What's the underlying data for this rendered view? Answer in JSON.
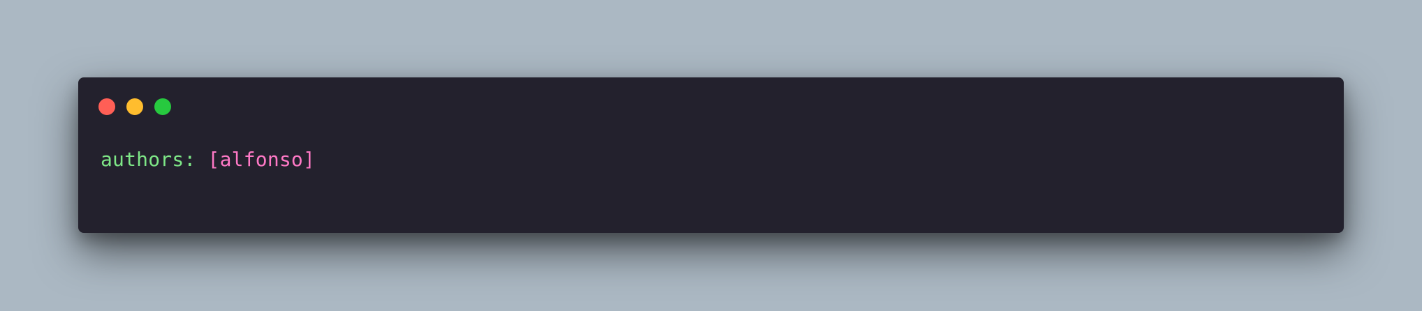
{
  "window": {
    "controls": [
      {
        "name": "close",
        "color": "#ff5f56"
      },
      {
        "name": "minimize",
        "color": "#ffbd2e"
      },
      {
        "name": "zoom",
        "color": "#27c93f"
      }
    ]
  },
  "code": {
    "key": "authors",
    "separator": ": ",
    "value": "[alfonso]"
  },
  "colors": {
    "background": "#abb8c3",
    "window": "#23212d",
    "key": "#7ee787",
    "value": "#ff79c6"
  }
}
